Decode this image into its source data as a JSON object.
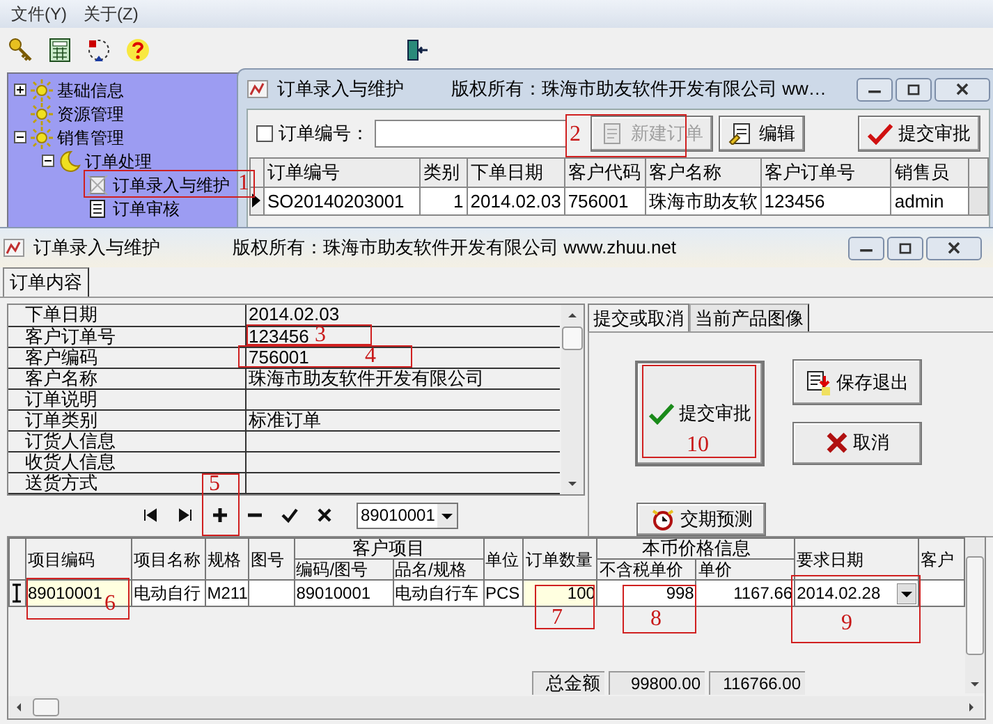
{
  "menu_bar": [
    {
      "label": "文件(Y)"
    },
    {
      "label": "关于(Z)"
    }
  ],
  "tree": [
    {
      "label": "基础信息",
      "kind": "module",
      "expanded": false
    },
    {
      "label": "资源管理",
      "kind": "module"
    },
    {
      "label": "销售管理",
      "kind": "module",
      "expanded": true,
      "children": [
        {
          "label": "订单处理",
          "kind": "folder",
          "expanded": true,
          "children": [
            {
              "label": "订单录入与维护",
              "kind": "form-edit"
            },
            {
              "label": "订单审核",
              "kind": "form"
            }
          ]
        }
      ]
    }
  ],
  "back_window": {
    "title": "订单录入与维护",
    "copyright": "版权所有：珠海市助友软件开发有限公司 ww…",
    "filter": {
      "checked": false,
      "label": "订单编号："
    },
    "buttons": [
      {
        "label": "新建订单",
        "kind": "new",
        "disabled": true
      },
      {
        "label": "编辑",
        "kind": "edit",
        "disabled": false
      },
      {
        "label": "提交审批",
        "kind": "submit",
        "disabled": false
      }
    ],
    "table": {
      "columns": [
        "订单编号",
        "类别",
        "下单日期",
        "客户代码",
        "客户名称",
        "客户订单号",
        "销售员"
      ],
      "rows": [
        {
          "selected": true,
          "cells": [
            "SO20140203001",
            "1",
            "2014.02.03",
            "756001",
            "珠海市助友软",
            "123456",
            "admin"
          ]
        }
      ]
    }
  },
  "front_window": {
    "title": "订单录入与维护",
    "copyright": "版权所有：珠海市助友软件开发有限公司 www.zhuu.net",
    "tabs": [
      {
        "label": "订单内容",
        "selected": true
      }
    ],
    "properties": [
      {
        "label": "下单日期",
        "value": "2014.02.03"
      },
      {
        "label": "客户订单号",
        "value": "123456"
      },
      {
        "label": "客户编码",
        "value": "756001"
      },
      {
        "label": "客户名称",
        "value": "珠海市助友软件开发有限公司"
      },
      {
        "label": "订单说明"
      },
      {
        "label": "订单类别",
        "value": "标准订单"
      },
      {
        "label": "订货人信息"
      },
      {
        "label": "收货人信息"
      },
      {
        "label": "送货方式"
      }
    ],
    "side_tabs": [
      {
        "label": "提交或取消",
        "selected": true
      },
      {
        "label": "当前产品图像",
        "selected": false
      }
    ],
    "buttons": [
      {
        "label": "提交审批",
        "kind": "submit"
      },
      {
        "label": "保存退出",
        "kind": "save"
      },
      {
        "label": "取消",
        "kind": "cancel"
      },
      {
        "label": "交期预测",
        "kind": "forecast"
      }
    ],
    "navigator": {
      "dropdown": "89010001"
    },
    "grid": {
      "groups": [
        {
          "label": "客户项目"
        },
        {
          "label": "本币价格信息"
        }
      ],
      "columns": [
        "项目编码",
        "项目名称",
        "规格",
        "图号",
        "编码/图号",
        "品名/规格",
        "单位",
        "订单数量",
        "不含税单价",
        "单价",
        "要求日期",
        "客户"
      ],
      "rows": [
        {
          "editing": true,
          "cells": [
            {
              "text": "89010001",
              "highlighted": true
            },
            {
              "text": "电动自行",
              "highlighted": false
            },
            {
              "text": "M211",
              "highlighted": false
            },
            {
              "highlighted": false
            },
            {
              "text": "89010001",
              "highlighted": false
            },
            {
              "text": "电动自行车",
              "highlighted": false
            },
            {
              "text": "PCS",
              "highlighted": false
            },
            {
              "text": "100",
              "highlighted": true
            },
            {
              "text": "998",
              "highlighted": false
            },
            {
              "text": "1167.66",
              "highlighted": false
            },
            {
              "text": "2014.02.28",
              "highlighted": false
            },
            {
              "highlighted": false
            }
          ]
        }
      ],
      "totals": {
        "label": "总金额",
        "values": [
          "99800.00",
          "116766.00"
        ]
      }
    }
  },
  "annotations": [
    {
      "label": "1"
    },
    {
      "label": "2"
    },
    {
      "label": "3"
    },
    {
      "label": "4"
    },
    {
      "label": "5"
    },
    {
      "label": "6"
    },
    {
      "label": "7"
    },
    {
      "label": "8"
    },
    {
      "label": "9"
    },
    {
      "label": "10"
    }
  ]
}
